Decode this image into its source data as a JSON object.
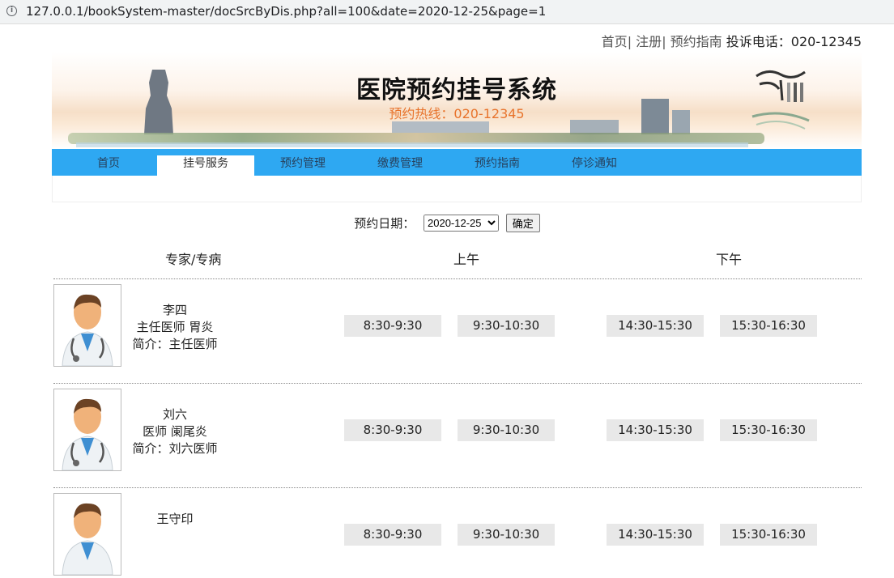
{
  "browser": {
    "url": "127.0.0.1/bookSystem-master/docSrcByDis.php?all=100&date=2020-12-25&page=1"
  },
  "toplinks": {
    "home": "首页",
    "sep1": "|",
    "register": "注册",
    "sep2": "|",
    "guide": "预约指南",
    "phone": "投诉电话：020-12345"
  },
  "banner": {
    "title": "医院预约挂号系统",
    "hotline": "预约热线：020-12345"
  },
  "nav": [
    "首页",
    "挂号服务",
    "预约管理",
    "缴费管理",
    "预约指南",
    "停诊通知"
  ],
  "nav_active": 1,
  "datebar": {
    "label": "预约日期：",
    "selected": "2020-12-25",
    "button": "确定"
  },
  "table": {
    "col_expert": "专家/专病",
    "col_am": "上午",
    "col_pm": "下午"
  },
  "doctors": [
    {
      "name": "李四",
      "title": "主任医师 胃炎",
      "intro": "简介：主任医师",
      "slots": [
        "8:30-9:30",
        "9:30-10:30",
        "14:30-15:30",
        "15:30-16:30"
      ]
    },
    {
      "name": "刘六",
      "title": "医师 阑尾炎",
      "intro": "简介：刘六医师",
      "slots": [
        "8:30-9:30",
        "9:30-10:30",
        "14:30-15:30",
        "15:30-16:30"
      ]
    },
    {
      "name": "王守印",
      "title": "",
      "intro": "",
      "slots": [
        "8:30-9:30",
        "9:30-10:30",
        "14:30-15:30",
        "15:30-16:30"
      ]
    }
  ]
}
